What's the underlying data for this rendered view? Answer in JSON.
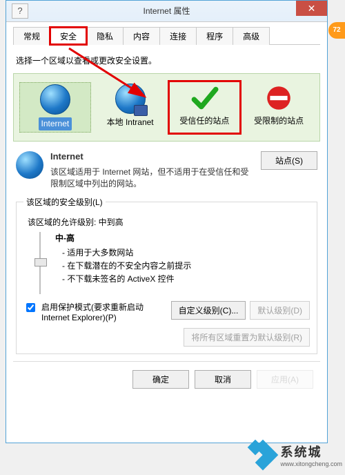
{
  "title": "Internet 属性",
  "help_glyph": "?",
  "close_glyph": "✕",
  "tabs": {
    "t0": "常规",
    "t1": "安全",
    "t2": "隐私",
    "t3": "内容",
    "t4": "连接",
    "t5": "程序",
    "t6": "高级"
  },
  "instruction": "选择一个区域以查看或更改安全设置。",
  "zones": {
    "internet": "Internet",
    "intranet": "本地 Intranet",
    "trusted": "受信任的站点",
    "restricted": "受限制的站点"
  },
  "info": {
    "heading": "Internet",
    "line1": "该区域适用于 Internet 网站，但不适用于在受信任和受限制区域中列出的网站。",
    "sites_btn": "站点(S)"
  },
  "security": {
    "legend": "该区域的安全级别(L)",
    "allowed_label": "该区域的允许级别: 中到高",
    "level": "中-高",
    "pt1": "- 适用于大多数网站",
    "pt2": "- 在下载潜在的不安全内容之前提示",
    "pt3": "- 不下载未签名的 ActiveX 控件",
    "protected_label": "启用保护模式(要求重新启动 Internet Explorer)(P)",
    "custom_btn": "自定义级别(C)...",
    "default_btn": "默认级别(D)",
    "reset_btn": "将所有区域重置为默认级别(R)"
  },
  "dialog": {
    "ok": "确定",
    "cancel": "取消",
    "apply": "应用(A)"
  },
  "badge": "72",
  "watermark": {
    "cn": "系统城",
    "url": "www.xitongcheng.com"
  }
}
